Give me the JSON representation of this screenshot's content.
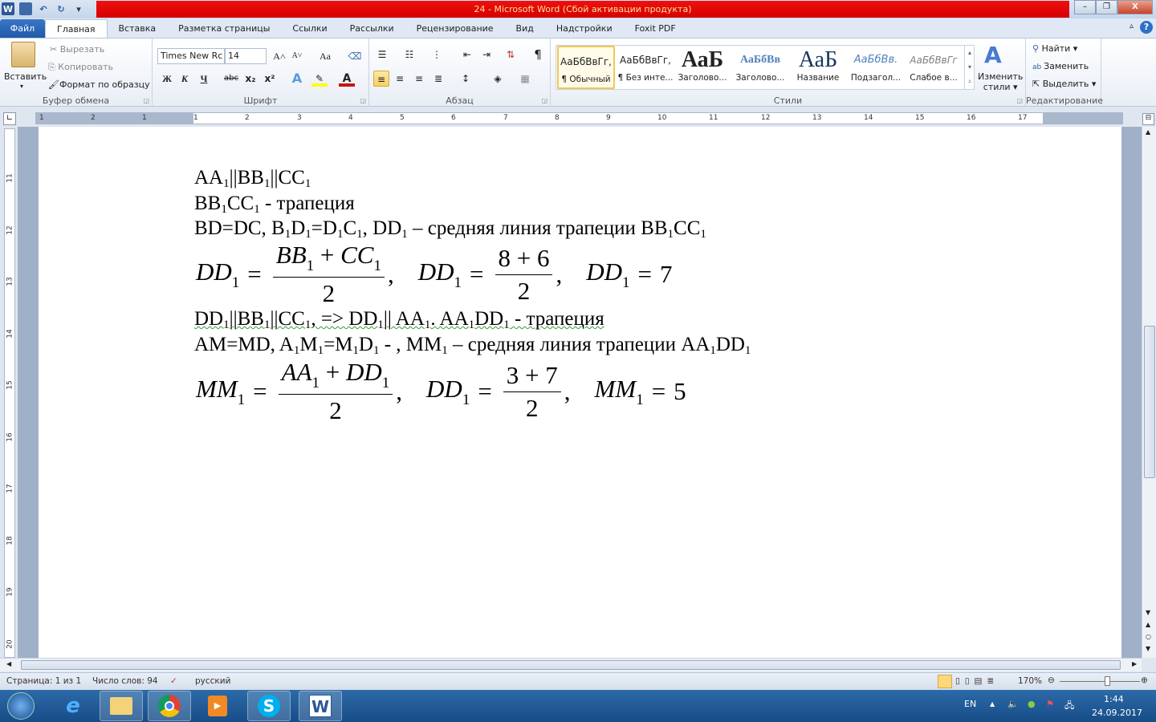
{
  "window": {
    "title": "24  -  Microsoft Word (Сбой активации продукта)",
    "minimize": "–",
    "maximize": "❐",
    "close": "X"
  },
  "qat": {
    "word_logo": "W",
    "save": "💾",
    "undo": "↶",
    "redo": "↻",
    "more": "▾"
  },
  "tabs": [
    "Файл",
    "Главная",
    "Вставка",
    "Разметка страницы",
    "Ссылки",
    "Рассылки",
    "Рецензирование",
    "Вид",
    "Надстройки",
    "Foxit PDF"
  ],
  "ribbon": {
    "clipboard": {
      "label": "Буфер обмена",
      "paste": "Вставить",
      "cut": "Вырезать",
      "copy": "Копировать",
      "format_painter": "Формат по образцу"
    },
    "font": {
      "label": "Шрифт",
      "font_name": "Times New Rc",
      "font_size": "14",
      "grow": "A˄",
      "shrink": "A˅",
      "case": "Aa",
      "bold": "Ж",
      "italic": "К",
      "underline": "Ч",
      "strike": "abc",
      "subscript": "x₂",
      "superscript": "x²"
    },
    "paragraph": {
      "label": "Абзац",
      "pilcrow": "¶"
    },
    "styles": {
      "label": "Стили",
      "items": [
        {
          "preview": "АаБбВвГг,",
          "name": "¶ Обычный"
        },
        {
          "preview": "АаБбВвГг,",
          "name": "¶ Без инте..."
        },
        {
          "preview": "АаБ",
          "name": "Заголово..."
        },
        {
          "preview": "АаБбВв",
          "name": "Заголово..."
        },
        {
          "preview": "АаБ",
          "name": "Название"
        },
        {
          "preview": "АаБбВв.",
          "name": "Подзагол..."
        },
        {
          "preview": "АаБбВвГг",
          "name": "Слабое в..."
        }
      ],
      "change_styles_1": "Изменить",
      "change_styles_2": "стили"
    },
    "editing": {
      "label": "Редактирование",
      "find": "Найти",
      "replace": "Заменить",
      "select": "Выделить"
    }
  },
  "ruler": {
    "h": [
      "1",
      "2",
      "1",
      "1",
      "2",
      "3",
      "4",
      "5",
      "6",
      "7",
      "8",
      "9",
      "10",
      "11",
      "12",
      "13",
      "14",
      "15",
      "16",
      "17"
    ],
    "v": [
      "11",
      "12",
      "13",
      "14",
      "15",
      "16",
      "17",
      "18",
      "19",
      "20"
    ]
  },
  "document": {
    "lines": [
      [
        {
          "t": "AA"
        },
        {
          "s": "1"
        },
        {
          "t": "||BB"
        },
        {
          "s": "1"
        },
        {
          "t": "||CC"
        },
        {
          "s": "1"
        }
      ],
      [
        {
          "t": "BB"
        },
        {
          "s": "1"
        },
        {
          "t": "CC"
        },
        {
          "s": "1"
        },
        {
          "t": " - трапеция"
        }
      ],
      [
        {
          "t": "BD=DC, B"
        },
        {
          "s": "1"
        },
        {
          "t": "D"
        },
        {
          "s": "1"
        },
        {
          "t": "=D"
        },
        {
          "s": "1"
        },
        {
          "t": "C"
        },
        {
          "s": "1"
        },
        {
          "t": ", DD"
        },
        {
          "s": "1"
        },
        {
          "t": " – средняя линия трапеции BB"
        },
        {
          "s": "1"
        },
        {
          "t": "CC"
        },
        {
          "s": "1"
        }
      ],
      [
        {
          "t": "DD"
        },
        {
          "s": "1"
        },
        {
          "t": "||BB"
        },
        {
          "s": "1"
        },
        {
          "t": "||CC"
        },
        {
          "s": "1"
        },
        {
          "t": ", => DD"
        },
        {
          "s": "1"
        },
        {
          "t": "|| AA"
        },
        {
          "s": "1"
        },
        {
          "t": ". AA"
        },
        {
          "s": "1"
        },
        {
          "t": "DD"
        },
        {
          "s": "1"
        },
        {
          "t": " - трапеция"
        }
      ],
      [
        {
          "t": "AM=MD, A"
        },
        {
          "s": "1"
        },
        {
          "t": "M"
        },
        {
          "s": "1"
        },
        {
          "t": "=M"
        },
        {
          "s": "1"
        },
        {
          "t": "D"
        },
        {
          "s": "1"
        },
        {
          "t": " - , MM"
        },
        {
          "s": "1"
        },
        {
          "t": " – средняя линия трапеции AA"
        },
        {
          "s": "1"
        },
        {
          "t": "DD"
        },
        {
          "s": "1"
        }
      ]
    ],
    "formulas": [
      [
        {
          "lhs": "DD",
          "sub": "1",
          "num": [
            {
              "v": "BB"
            },
            {
              "s": "1"
            },
            {
              "t": " + "
            },
            {
              "v": "CC"
            },
            {
              "s": "1"
            }
          ],
          "den": "2",
          "after": ","
        },
        {
          "lhs": "DD",
          "sub": "1",
          "num": [
            {
              "t": "8 + 6"
            }
          ],
          "den": "2",
          "after": ","
        },
        {
          "lhs": "DD",
          "sub": "1",
          "rhs": "7"
        }
      ],
      [
        {
          "lhs": "MM",
          "sub": "1",
          "num": [
            {
              "v": "AA"
            },
            {
              "s": "1"
            },
            {
              "t": " + "
            },
            {
              "v": "DD"
            },
            {
              "s": "1"
            }
          ],
          "den": "2",
          "after": ","
        },
        {
          "lhs": "DD",
          "sub": "1",
          "num": [
            {
              "t": "3 + 7"
            }
          ],
          "den": "2",
          "after": ","
        },
        {
          "lhs": "MM",
          "sub": "1",
          "rhs": "5"
        }
      ]
    ]
  },
  "status": {
    "page": "Страница: 1 из 1",
    "words": "Число слов: 94",
    "language": "русский",
    "zoom": "170%",
    "zoom_fraction": 0.6
  },
  "taskbar": {
    "lang": "EN",
    "time": "1:44",
    "date": "24.09.2017"
  }
}
